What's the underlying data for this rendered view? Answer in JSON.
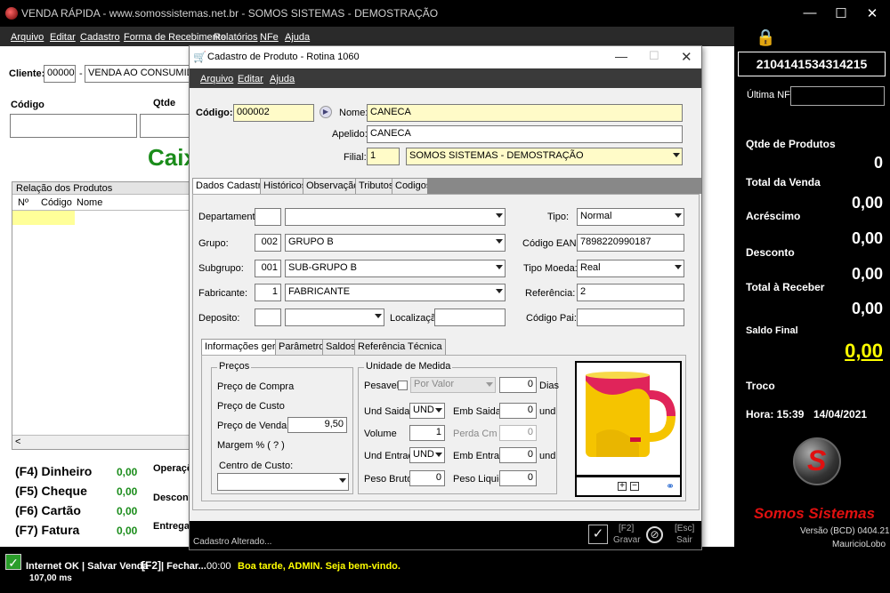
{
  "window": {
    "title": "VENDA RÁPIDA - www.somossistemas.net.br - SOMOS SISTEMAS - DEMOSTRAÇÃO"
  },
  "menu": [
    "Arquivo",
    "Editar",
    "Cadastro",
    "Forma de Recebimento",
    "Relatórios",
    "NFe",
    "Ajuda"
  ],
  "main": {
    "cliente_label": "Cliente:",
    "cliente_code": "000001",
    "cliente_name": "VENDA AO CONSUMIDOR",
    "codigo_label": "Código",
    "qtde_label": "Qtde",
    "caixa_text": "Caix",
    "relacao_title": "Relação dos Produtos",
    "cols": [
      "Nº",
      "Código",
      "Nome"
    ],
    "payments": [
      {
        "label": "(F4) Dinheiro",
        "value": "0,00"
      },
      {
        "label": "(F5) Cheque",
        "value": "0,00"
      },
      {
        "label": "(F6) Cartão",
        "value": "0,00"
      },
      {
        "label": "(F7) Fatura",
        "value": "0,00"
      }
    ],
    "operacao_label": "Operaçõ",
    "desconto_label": "Desconto",
    "entrega_label": "Entrega:"
  },
  "side": {
    "code": "2104141534314215",
    "ultima_label": "Última NFC-e",
    "qtde_label": "Qtde de Produtos",
    "qtde_value": "0",
    "total_label": "Total da Venda",
    "total_value": "0,00",
    "acrescimo_label": "Acréscimo",
    "acrescimo_value": "0,00",
    "desconto_label": "Desconto",
    "desconto_value": "0,00",
    "receber_label": "Total à Receber",
    "receber_value": "0,00",
    "saldo_label": "Saldo Final",
    "saldo_value": "0,00",
    "troco_label": "Troco",
    "hora": "Hora: 15:39",
    "data": "14/04/2021",
    "brand": "Somos Sistemas",
    "versao": "Versão (BCD) 0404.21",
    "user": "MauricioLobo"
  },
  "status": {
    "internet": "Internet OK",
    "ping": "107,00 ms",
    "salvar": "| Salvar Venda",
    "f2": "[F2]",
    "fechar": "| Fechar...",
    "time": "00:00",
    "msg": "Boa tarde, ADMIN. Seja bem-vindo."
  },
  "dialog": {
    "title": "Cadastro de Produto - Rotina 1060",
    "menu": [
      "Arquivo",
      "Editar",
      "Ajuda"
    ],
    "codigo_label": "Código:",
    "codigo": "000002",
    "nome_label": "Nome:",
    "nome": "CANECA",
    "apelido_label": "Apelido:",
    "apelido": "CANECA",
    "filial_label": "Filial:",
    "filial_code": "1",
    "filial_name": "SOMOS SISTEMAS - DEMOSTRAÇÃO",
    "tabs": [
      "Dados Cadastrais",
      "Históricos",
      "Observação",
      "Tributos",
      "Codigos"
    ],
    "departamento_label": "Departamento:",
    "grupo_label": "Grupo:",
    "grupo_code": "002",
    "grupo_name": "GRUPO B",
    "subgrupo_label": "Subgrupo:",
    "subgrupo_code": "001",
    "subgrupo_name": "SUB-GRUPO B",
    "fabricante_label": "Fabricante:",
    "fabricante_code": "1",
    "fabricante_name": "FABRICANTE",
    "deposito_label": "Deposito:",
    "localizacao_label": "Localização:",
    "tipo_label": "Tipo:",
    "tipo": "Normal",
    "ean_label": "Código EAN:",
    "ean": "7898220990187",
    "moeda_label": "Tipo Moeda:",
    "moeda": "Real",
    "referencia_label": "Referência:",
    "referencia": "2",
    "codpai_label": "Código Pai:",
    "subtabs": [
      "Informações gerais",
      "Parâmetros",
      "Saldos",
      "Referência Técnica"
    ],
    "precos_title": "Preços",
    "preco_compra_label": "Preço de Compra",
    "preco_custo_label": "Preço de Custo",
    "preco_venda_label": "Preço de Venda",
    "preco_venda": "9,50",
    "margem_label": "Margem % ( ? )",
    "centro_label": "Centro de Custo:",
    "unidade_title": "Unidade de Medida",
    "pesavel_label": "Pesavel",
    "porvalor": "Por Valor",
    "dias_value": "0",
    "dias_label": "Dias",
    "und_saida_label": "Und Saida",
    "und_saida": "UND",
    "emb_saida_label": "Emb Saida",
    "emb_saida": "0",
    "und_label": "und",
    "volume_label": "Volume",
    "volume": "1",
    "perda_label": "Perda Cm",
    "perda": "0",
    "und_entrada_label": "Und Entrada",
    "und_entrada": "UND",
    "emb_entrada_label": "Emb Entrada",
    "emb_entrada": "0",
    "peso_bruto_label": "Peso Bruto",
    "peso_bruto": "0",
    "peso_liquido_label": "Peso Liquido",
    "peso_liquido": "0",
    "status": "Cadastro Alterado...",
    "gravar_key": "[F2]",
    "gravar_label": "Gravar",
    "sair_key": "[Esc]",
    "sair_label": "Sair"
  }
}
